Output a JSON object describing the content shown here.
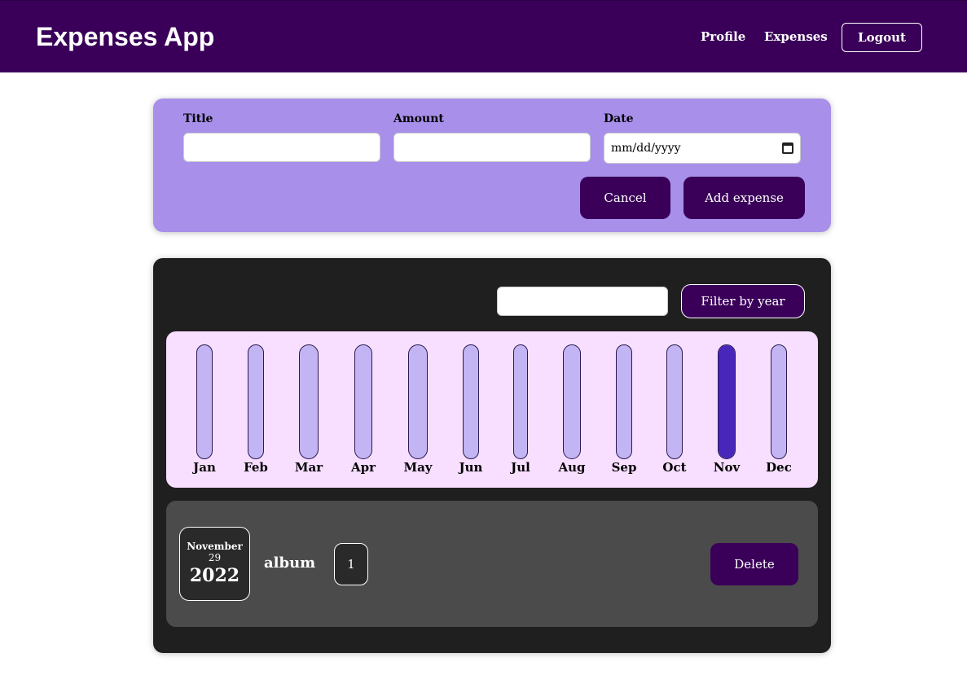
{
  "header": {
    "title": "Expenses App",
    "nav": {
      "profile": "Profile",
      "expenses": "Expenses"
    },
    "logout_label": "Logout"
  },
  "form": {
    "title_label": "Title",
    "title_value": "",
    "amount_label": "Amount",
    "amount_value": "",
    "date_label": "Date",
    "date_placeholder": "mm/dd/yyyy",
    "cancel_label": "Cancel",
    "submit_label": "Add expense"
  },
  "filter": {
    "input_value": "",
    "button_label": "Filter by year"
  },
  "colors": {
    "header_bg": "#3a0059",
    "form_bg": "#a78fea",
    "bar_empty": "#c3b4f3",
    "bar_fill": "#4826b9",
    "chart_bg": "#f8dfff"
  },
  "chart_data": {
    "type": "bar",
    "categories": [
      "Jan",
      "Feb",
      "Mar",
      "Apr",
      "May",
      "Jun",
      "Jul",
      "Aug",
      "Sep",
      "Oct",
      "Nov",
      "Dec"
    ],
    "values": [
      0,
      0,
      0,
      0,
      0,
      0,
      0,
      0,
      0,
      0,
      1,
      0
    ],
    "ylim": [
      0,
      1
    ],
    "title": "",
    "xlabel": "",
    "ylabel": "",
    "grid": false
  },
  "expenses": [
    {
      "month": "November",
      "day": "29",
      "year": "2022",
      "title": "album",
      "amount": "1",
      "delete_label": "Delete"
    }
  ]
}
